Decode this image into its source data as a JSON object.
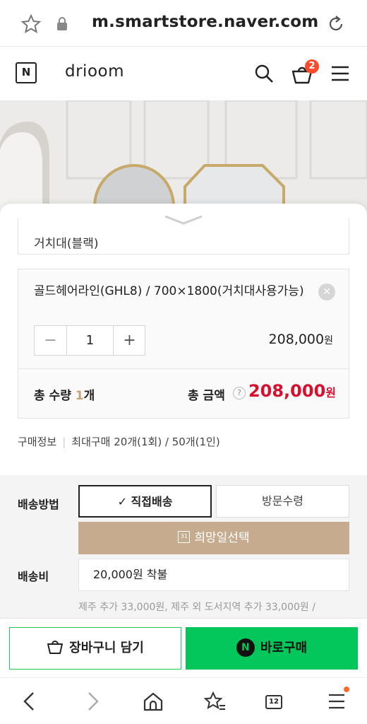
{
  "browser": {
    "url": "m.smartstore.naver.com",
    "tab_count": "12"
  },
  "header": {
    "logo_letter": "N",
    "brand": "drioom",
    "cart_count": "2"
  },
  "option_select": {
    "value": "거치대(블랙)"
  },
  "selected_option": {
    "name": "골드헤어라인(GHL8) / 700×1800(거치대사용가능)",
    "quantity": "1",
    "minus": "−",
    "plus": "+",
    "price": "208,000",
    "price_unit": "원"
  },
  "total": {
    "qty_label": "총 수량",
    "qty_value": "1",
    "qty_unit": "개",
    "amount_label": "총 금액",
    "help": "?",
    "amount": "208,000",
    "amount_unit": "원"
  },
  "purchase_info": {
    "label": "구매정보",
    "text": "최대구매 20개(1회) / 50개(1인)"
  },
  "shipping": {
    "method_label": "배송방법",
    "options": [
      "✓ 직접배송",
      "방문수령"
    ],
    "selected": "직접배송",
    "date_button": "희망일선택",
    "calendar_day": "31",
    "fee_label": "배송비",
    "fee_value": "20,000원 착불",
    "note": "제주 추가 33,000원, 제주 외 도서지역 추가 33,000원 /"
  },
  "actions": {
    "cart": "장바구니 담기",
    "buy": "바로구매",
    "npay_letter": "N"
  },
  "colors": {
    "accent_green": "#03c75a",
    "price_red": "#d7102e",
    "beige": "#c6ab8e"
  }
}
